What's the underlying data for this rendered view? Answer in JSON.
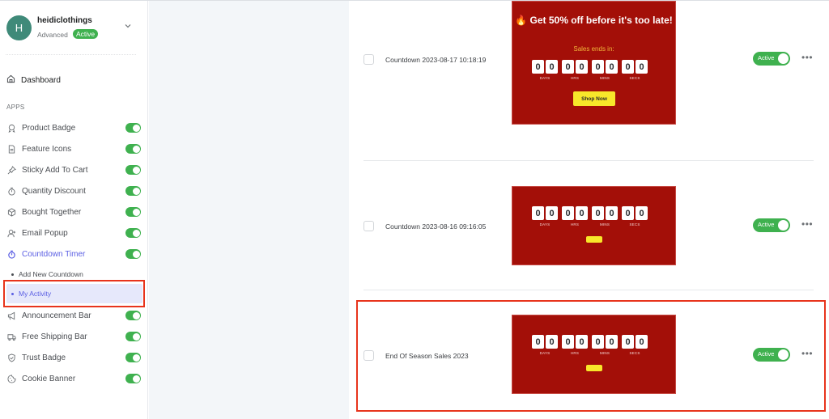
{
  "store": {
    "initial": "H",
    "name": "heidiclothings",
    "plan": "Advanced",
    "plan_status": "Active"
  },
  "nav": {
    "dashboard": "Dashboard",
    "section_label": "APPS",
    "apps": [
      {
        "label": "Product Badge",
        "icon": "badge-icon",
        "enabled": true
      },
      {
        "label": "Feature Icons",
        "icon": "document-icon",
        "enabled": true
      },
      {
        "label": "Sticky Add To Cart",
        "icon": "pin-icon",
        "enabled": true
      },
      {
        "label": "Quantity Discount",
        "icon": "stopwatch-icon",
        "enabled": true
      },
      {
        "label": "Bought Together",
        "icon": "box-icon",
        "enabled": true
      },
      {
        "label": "Email Popup",
        "icon": "add-user-icon",
        "enabled": true
      },
      {
        "label": "Countdown Timer",
        "icon": "timer-icon",
        "enabled": true,
        "active": true
      }
    ],
    "countdown_sub": [
      {
        "label": "Add New Countdown"
      },
      {
        "label": "My Activity",
        "selected": true
      }
    ],
    "apps_after": [
      {
        "label": "Announcement Bar",
        "icon": "megaphone-icon",
        "enabled": true
      },
      {
        "label": "Free Shipping Bar",
        "icon": "truck-icon",
        "enabled": true
      },
      {
        "label": "Trust Badge",
        "icon": "shield-icon",
        "enabled": true
      },
      {
        "label": "Cookie Banner",
        "icon": "cookie-icon",
        "enabled": true
      }
    ]
  },
  "countdowns": [
    {
      "title": "Countdown 2023-08-17 10:18:19",
      "status": "Active",
      "preview": {
        "heading_icon": "🔥",
        "heading": "Get 50% off before it's too late!",
        "subheading": "Sales ends in:",
        "digits": [
          "0",
          "0",
          "0",
          "0",
          "0",
          "0",
          "0",
          "0"
        ],
        "units": [
          "DAYS",
          "HRS",
          "MINS",
          "SECS"
        ],
        "button": "Shop Now"
      }
    },
    {
      "title": "Countdown 2023-08-16 09:16:05",
      "status": "Active",
      "preview": {
        "digits": [
          "0",
          "0",
          "0",
          "0",
          "0",
          "0",
          "0",
          "0"
        ],
        "units": [
          "DAYS",
          "HRS",
          "MINS",
          "SECS"
        ],
        "button": ""
      }
    },
    {
      "title": "End Of Season Sales 2023",
      "status": "Active",
      "preview": {
        "digits": [
          "0",
          "0",
          "0",
          "0",
          "0",
          "0",
          "0",
          "0"
        ],
        "units": [
          "DAYS",
          "HRS",
          "MINS",
          "SECS"
        ],
        "button": ""
      }
    }
  ],
  "more_icon": "•••",
  "colors": {
    "accent": "#5b5fe3",
    "success": "#3fb14f",
    "preview_bg": "#a30f08",
    "preview_button": "#f8e72a",
    "highlight": "#e8341c"
  }
}
